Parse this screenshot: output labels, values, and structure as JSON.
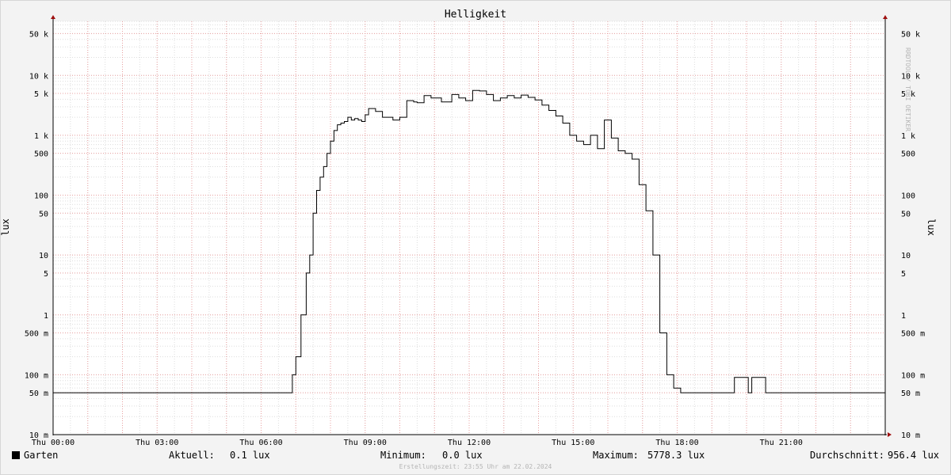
{
  "chart_data": {
    "type": "line",
    "title": "Helligkeit",
    "ylabel": "lux",
    "y_scale": "log",
    "ylim": [
      0.01,
      80000
    ],
    "xlim_hours": [
      0,
      24
    ],
    "x_ticks": [
      "Thu 00:00",
      "Thu 03:00",
      "Thu 06:00",
      "Thu 09:00",
      "Thu 12:00",
      "Thu 15:00",
      "Thu 18:00",
      "Thu 21:00"
    ],
    "y_ticks": [
      {
        "value": 0.01,
        "label": "10 m"
      },
      {
        "value": 0.05,
        "label": "50 m"
      },
      {
        "value": 0.1,
        "label": "100 m"
      },
      {
        "value": 0.5,
        "label": "500 m"
      },
      {
        "value": 1,
        "label": "1"
      },
      {
        "value": 5,
        "label": "5"
      },
      {
        "value": 10,
        "label": "10"
      },
      {
        "value": 50,
        "label": "50"
      },
      {
        "value": 100,
        "label": "100"
      },
      {
        "value": 500,
        "label": "500"
      },
      {
        "value": 1000,
        "label": "1 k"
      },
      {
        "value": 5000,
        "label": "5 k"
      },
      {
        "value": 10000,
        "label": "10 k"
      },
      {
        "value": 50000,
        "label": "50 k"
      }
    ],
    "grid": true,
    "series": [
      {
        "name": "Garten",
        "color": "#000000",
        "x_hours": [
          0.0,
          6.85,
          6.9,
          7.0,
          7.15,
          7.3,
          7.4,
          7.5,
          7.6,
          7.7,
          7.8,
          7.9,
          8.0,
          8.1,
          8.2,
          8.3,
          8.4,
          8.5,
          8.6,
          8.7,
          8.8,
          8.9,
          9.0,
          9.1,
          9.3,
          9.5,
          9.8,
          10.0,
          10.2,
          10.4,
          10.5,
          10.7,
          10.9,
          11.2,
          11.5,
          11.7,
          11.9,
          12.1,
          12.3,
          12.5,
          12.7,
          12.9,
          13.1,
          13.3,
          13.5,
          13.7,
          13.9,
          14.1,
          14.3,
          14.5,
          14.7,
          14.9,
          15.1,
          15.3,
          15.5,
          15.7,
          15.9,
          16.1,
          16.3,
          16.5,
          16.7,
          16.9,
          17.1,
          17.3,
          17.5,
          17.7,
          17.9,
          18.1,
          18.3,
          18.5,
          18.6,
          18.7,
          18.8,
          19.6,
          19.65,
          20.0,
          20.05,
          20.1,
          20.15,
          20.5,
          20.55,
          24.0
        ],
        "values": [
          0.05,
          0.05,
          0.1,
          0.2,
          1.0,
          5.0,
          10.0,
          50.0,
          120.0,
          200.0,
          300.0,
          500.0,
          800.0,
          1200.0,
          1500.0,
          1600.0,
          1700.0,
          2000.0,
          1800.0,
          1900.0,
          1800.0,
          1700.0,
          2200.0,
          2800.0,
          2500.0,
          2000.0,
          1800.0,
          2000.0,
          3800.0,
          3600.0,
          3500.0,
          4600.0,
          4200.0,
          3600.0,
          4800.0,
          4200.0,
          3800.0,
          5600.0,
          5500.0,
          4800.0,
          3800.0,
          4200.0,
          4600.0,
          4200.0,
          4700.0,
          4300.0,
          3900.0,
          3200.0,
          2600.0,
          2100.0,
          1600.0,
          1000.0,
          800.0,
          700.0,
          1000.0,
          600.0,
          1800.0,
          900.0,
          550.0,
          500.0,
          400.0,
          150.0,
          55.0,
          10.0,
          0.5,
          0.1,
          0.06,
          0.05,
          0.05,
          0.05,
          0.05,
          0.05,
          0.05,
          0.05,
          0.09,
          0.09,
          0.05,
          0.05,
          0.09,
          0.09,
          0.05,
          0.05
        ]
      }
    ],
    "legend": {
      "series_label": "Garten",
      "current_label": "Aktuell:",
      "current_value": "0.1 lux",
      "min_label": "Minimum:",
      "min_value": "0.0 lux",
      "max_label": "Maximum:",
      "max_value": "5778.3 lux",
      "avg_label": "Durchschnitt:",
      "avg_value": "956.4 lux"
    }
  },
  "watermark": "RRDTOOL / TOBI OETIKER",
  "footer": "Erstellungszeit: 23:55 Uhr am 22.02.2024",
  "colors": {
    "background": "#f3f3f3",
    "canvas": "#ffffff",
    "major_grid": "#e8a0a0",
    "minor_grid": "#dddddd",
    "axis": "#000000",
    "arrow": "#a01010"
  }
}
